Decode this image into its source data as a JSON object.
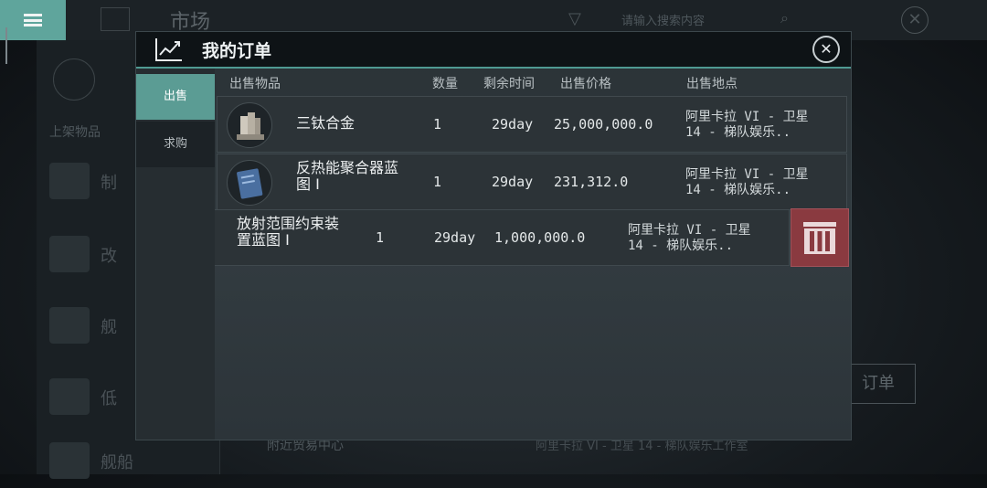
{
  "background": {
    "title": "市场",
    "search_placeholder": "请输入搜索内容",
    "shelf_label": "上架物品",
    "side_items": [
      "制",
      "改",
      "舰",
      "低",
      "舰船"
    ],
    "order_button": "订单",
    "footer_left": "附近贸易中心",
    "footer_right": "阿里卡拉 VI - 卫星 14 - 梯队娱乐工作室"
  },
  "modal": {
    "title": "我的订单",
    "tabs": [
      "出售",
      "求购"
    ],
    "columns": {
      "item": "出售物品",
      "qty": "数量",
      "time": "剩余时间",
      "price": "出售价格",
      "location": "出售地点"
    },
    "orders": [
      {
        "name": "三钛合金",
        "qty": "1",
        "time": "29day",
        "price": "25,000,000.0",
        "loc1": "阿里卡拉 VI - 卫星",
        "loc2": "14 - 梯队娱乐.."
      },
      {
        "name1": "反热能聚合器蓝",
        "name2": "图 I",
        "qty": "1",
        "time": "29day",
        "price": "231,312.0",
        "loc1": "阿里卡拉 VI - 卫星",
        "loc2": "14 - 梯队娱乐.."
      },
      {
        "name1": "放射范围约束装",
        "name2": "置蓝图 I",
        "qty": "1",
        "time": "29day",
        "price": "1,000,000.0",
        "loc1": "阿里卡拉 VI - 卫星",
        "loc2": "14 - 梯队娱乐.."
      }
    ]
  },
  "colors": {
    "accent": "#5b9c94",
    "delete": "#8a3a40"
  }
}
